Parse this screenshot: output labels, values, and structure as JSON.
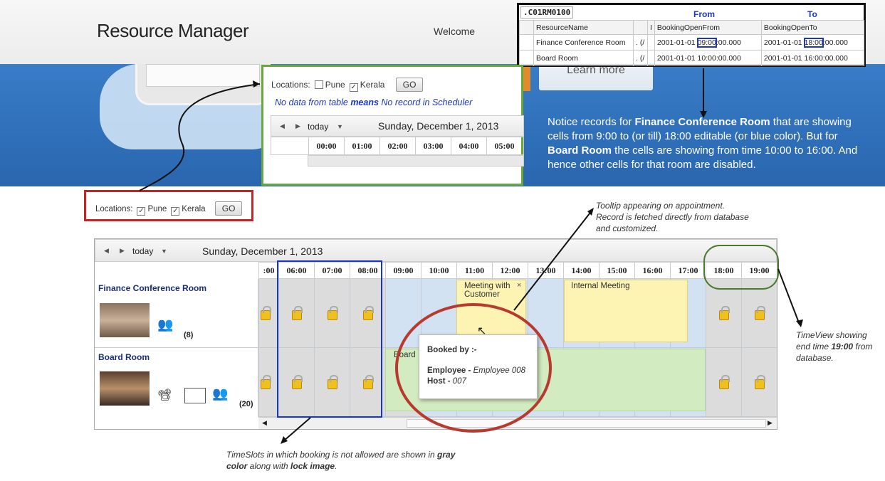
{
  "header": {
    "logo": "Resource Manager",
    "welcome": "Welcome",
    "learn_more": "Learn more"
  },
  "hero_text": {
    "p1": "Notice records for ",
    "b1": "Finance Conference Room",
    "p2": " that are showing cells from 9:00 to (or till) 18:00 editable (or blue color). But for ",
    "b2": "Board Room",
    "p3": " the cells are showing from time 10:00 to 16:00. And hence other cells for that room are disabled."
  },
  "db": {
    "tab": ".C01RM0100",
    "from": "From",
    "to": "To",
    "columns": [
      "ResourceName",
      "I",
      "BookingOpenFrom",
      "BookingOpenTo"
    ],
    "rows": [
      {
        "name": "Finance Conference Room",
        "i": ". (/",
        "from_a": "2001-01-01 ",
        "from_b": "09:00",
        "from_c": ":00.000",
        "to_a": "2001-01-01 ",
        "to_b": "18:00",
        "to_c": ":00.000"
      },
      {
        "name": "Board Room",
        "i": ". (/",
        "from": "2001-01-01 10:00:00.000",
        "to": "2001-01-01 16:00:00.000"
      }
    ]
  },
  "inset": {
    "locations": "Locations:",
    "pune": "Pune",
    "kerala": "Kerala",
    "go": "GO",
    "nodata_a": "No data from table ",
    "nodata_b": "means",
    "nodata_c": " No record in Scheduler",
    "today": "today",
    "date": "Sunday, December 1, 2013",
    "slots": [
      "00:00",
      "01:00",
      "02:00",
      "03:00",
      "04:00",
      "05:00"
    ]
  },
  "filter": {
    "locations": "Locations:",
    "pune": "Pune",
    "kerala": "Kerala",
    "go": "GO"
  },
  "scheduler": {
    "today": "today",
    "date": "Sunday, December 1, 2013",
    "slots": [
      ":00",
      "06:00",
      "07:00",
      "08:00",
      "09:00",
      "10:00",
      "11:00",
      "12:00",
      "13:00",
      "14:00",
      "15:00",
      "16:00",
      "17:00",
      "18:00",
      "19:00"
    ],
    "rooms": [
      {
        "name": "Finance Conference Room",
        "capacity": "(8)"
      },
      {
        "name": "Board Room",
        "capacity": "(20)"
      }
    ],
    "appointments": {
      "meeting": "Meeting with Customer",
      "internal": "Internal Meeting",
      "board": "Board"
    },
    "tooltip": {
      "title": "Booked by :-",
      "emp_label": "Employee - ",
      "emp_val": "Employee 008",
      "host_label": "Host - ",
      "host_val": "007"
    }
  },
  "notes": {
    "tooltip_note": "Tooltip appearing on appointment. Record is fetched directly from database and customized.",
    "timeview_a": "TimeView showing end time ",
    "timeview_b": "19:00",
    "timeview_c": " from database.",
    "timeslots_a": "TimeSlots in which booking is not allowed are shown in ",
    "timeslots_b": "gray color",
    "timeslots_c": " along with ",
    "timeslots_d": "lock image",
    "timeslots_e": "."
  },
  "colors": {
    "red": "#c42524",
    "green": "#6aa83b",
    "blue": "#1a35c9",
    "dark_green": "#4a7a30",
    "oval_red": "#b83a2e"
  }
}
